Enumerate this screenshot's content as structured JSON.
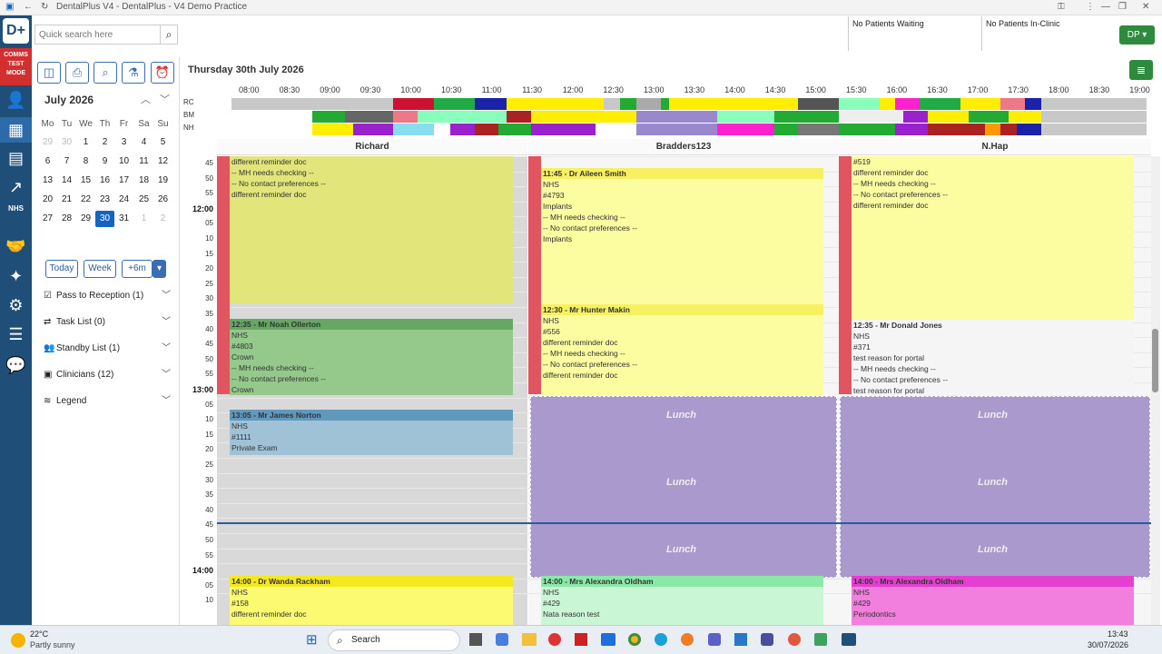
{
  "window": {
    "title": "DentalPlus V4 - DentalPlus - V4 Demo Practice"
  },
  "header": {
    "search_placeholder": "Quick search here",
    "waiting": "No Patients Waiting",
    "in_clinic": "No Patients In-Clinic",
    "user": "DP"
  },
  "rail": {
    "comms": "COMMS TEST MODE"
  },
  "calendar": {
    "month": "July 2026",
    "weekdays": [
      "Mo",
      "Tu",
      "We",
      "Th",
      "Fr",
      "Sa",
      "Su"
    ],
    "weeks": [
      [
        "29",
        "30",
        "1",
        "2",
        "3",
        "4",
        "5"
      ],
      [
        "6",
        "7",
        "8",
        "9",
        "10",
        "11",
        "12"
      ],
      [
        "13",
        "14",
        "15",
        "16",
        "17",
        "18",
        "19"
      ],
      [
        "20",
        "21",
        "22",
        "23",
        "24",
        "25",
        "26"
      ],
      [
        "27",
        "28",
        "29",
        "30",
        "31",
        "1",
        "2"
      ]
    ]
  },
  "view_buttons": {
    "today": "Today",
    "week": "Week",
    "six": "+6m"
  },
  "panels": [
    "Pass to Reception (1)",
    "Task List (0)",
    "Standby List (1)",
    "Clinicians (12)",
    "Legend"
  ],
  "main": {
    "date": "Thursday 30th July 2026"
  },
  "timeline": {
    "times": [
      "08:00",
      "08:30",
      "09:00",
      "09:30",
      "10:00",
      "10:30",
      "11:00",
      "11:30",
      "12:00",
      "12:30",
      "13:00",
      "13:30",
      "14:00",
      "14:30",
      "15:00",
      "15:30",
      "16:00",
      "16:30",
      "17:00",
      "17:30",
      "18:00",
      "18:30",
      "19:00"
    ],
    "rows": [
      "RC",
      "BM",
      "NH"
    ]
  },
  "columns": [
    "Richard",
    "Bradders123",
    "N.Hap"
  ],
  "times": [
    {
      "l": "45"
    },
    {
      "l": "50"
    },
    {
      "l": "55"
    },
    {
      "l": "12:00",
      "hr": true
    },
    {
      "l": "05"
    },
    {
      "l": "10"
    },
    {
      "l": "15"
    },
    {
      "l": "20"
    },
    {
      "l": "25"
    },
    {
      "l": "30"
    },
    {
      "l": "35"
    },
    {
      "l": "40"
    },
    {
      "l": "45"
    },
    {
      "l": "50"
    },
    {
      "l": "55"
    },
    {
      "l": "13:00",
      "hr": true
    },
    {
      "l": "05"
    },
    {
      "l": "10"
    },
    {
      "l": "15"
    },
    {
      "l": "20"
    },
    {
      "l": "25"
    },
    {
      "l": "30"
    },
    {
      "l": "35"
    },
    {
      "l": "40"
    },
    {
      "l": "45"
    },
    {
      "l": "50"
    },
    {
      "l": "55"
    },
    {
      "l": "14:00",
      "hr": true
    },
    {
      "l": "05"
    },
    {
      "l": "10"
    }
  ],
  "appointments": {
    "r1": {
      "lines": [
        "different reminder doc",
        "-- MH needs checking --",
        "-- No contact preferences --",
        "different reminder doc"
      ]
    },
    "r2": {
      "title": "12:35 - Mr Noah Ollerton",
      "lines": [
        "NHS",
        "#4803",
        "Crown",
        "-- MH needs checking --",
        "-- No contact preferences --",
        "Crown"
      ]
    },
    "r3": {
      "title": "13:05 - Mr James Norton",
      "lines": [
        "NHS",
        "#1111",
        "Private Exam"
      ]
    },
    "r4": {
      "title": "14:00 - Dr Wanda Rackham",
      "lines": [
        "NHS",
        "#158",
        "different reminder doc"
      ]
    },
    "b1": {
      "title": "11:45 - Dr Aileen Smith",
      "lines": [
        "NHS",
        "#4793",
        "Implants",
        "-- MH needs checking --",
        "-- No contact preferences --",
        "Implants"
      ]
    },
    "b2": {
      "title": "12:30 - Mr Hunter Makin",
      "lines": [
        "NHS",
        "#556",
        "different reminder doc",
        "-- MH needs checking --",
        "-- No contact preferences --",
        "different reminder doc"
      ]
    },
    "b3": {
      "title": "14:00 - Mrs Alexandra Oldham",
      "lines": [
        "NHS",
        "#429",
        "Nata reason test"
      ]
    },
    "n1": {
      "lines": [
        "#519",
        "different reminder doc",
        "-- MH needs checking --",
        "-- No contact preferences --",
        "different reminder doc"
      ]
    },
    "n2": {
      "title": "12:35 - Mr Donald Jones",
      "lines": [
        "NHS",
        "#371",
        "test reason for portal",
        "-- MH needs checking --",
        "-- No contact preferences --",
        "test reason for portal"
      ]
    },
    "n3": {
      "title": "14:00 - Mrs Alexandra Oldham",
      "lines": [
        "NHS",
        "#429",
        "Periodontics"
      ]
    }
  },
  "lunch": "Lunch",
  "taskbar": {
    "temp": "22°C",
    "weather": "Partly sunny",
    "search": "Search",
    "time": "13:43",
    "date": "30/07/2026"
  }
}
